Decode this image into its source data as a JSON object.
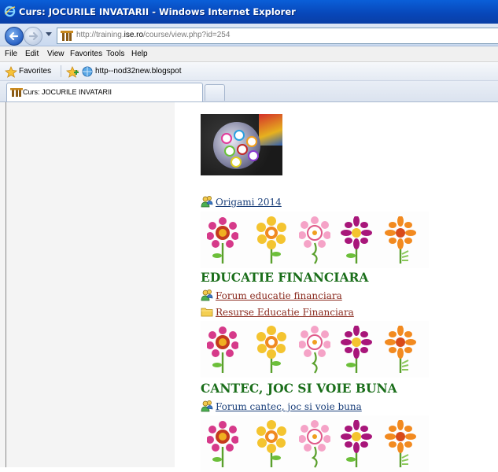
{
  "window": {
    "title": "Curs: JOCURILE INVATARII - Windows Internet Explorer",
    "icon": "ie-icon"
  },
  "address_bar": {
    "url_prefix": "http://training.",
    "url_domain": "ise.ro",
    "url_suffix": "/course/view.php?id=254"
  },
  "menu": {
    "items": [
      "File",
      "Edit",
      "View",
      "Favorites",
      "Tools",
      "Help"
    ]
  },
  "favorites_bar": {
    "favorites_label": "Favorites",
    "link_label": "http--nod32new.blogspot"
  },
  "tabs": [
    {
      "label": "Curs: JOCURILE INVATARII"
    }
  ],
  "content": {
    "link_origami": "Origami 2014",
    "section1_heading": "EDUCATIE FINANCIARA",
    "forum1": "Forum educatie financiara",
    "resource1": "Resurse Educatie Financiara",
    "section2_heading": "CANTEC, JOC SI VOIE BUNA",
    "forum2": "Forum cantec, joc si voie buna"
  },
  "colors": {
    "heading": "#1a6e1a",
    "link": "#1a3f7a",
    "visited_link": "#8a2a1e",
    "titlebar": "#0a4fc4"
  }
}
